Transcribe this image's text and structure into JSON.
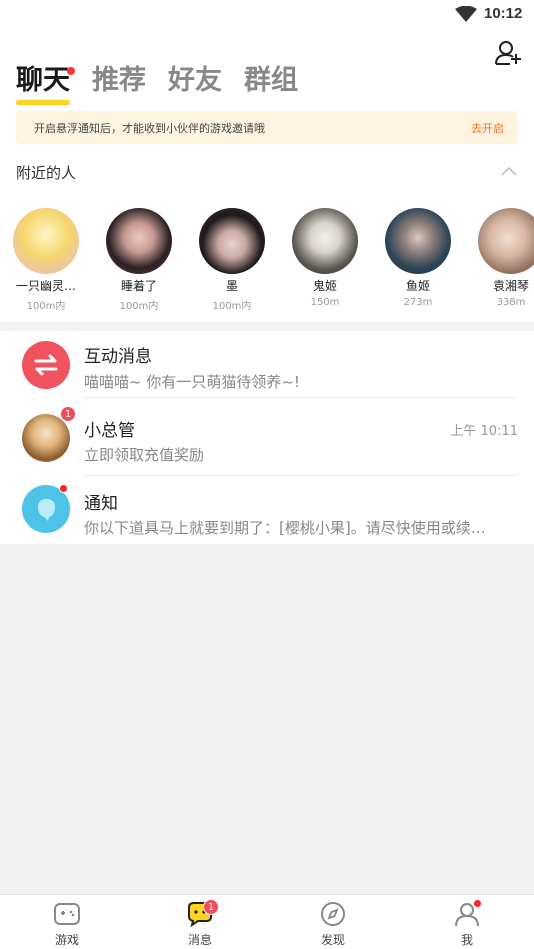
{
  "status_bar": {
    "time": "10:12"
  },
  "tabs": [
    {
      "label": "聊天",
      "active": true,
      "has_dot": true
    },
    {
      "label": "推荐",
      "active": false
    },
    {
      "label": "好友",
      "active": false
    },
    {
      "label": "群组",
      "active": false
    }
  ],
  "notice": {
    "text": "开启悬浮通知后，才能收到小伙伴的游戏邀请哦",
    "action": "去开启"
  },
  "nearby": {
    "title": "附近的人",
    "people": [
      {
        "name": "一只幽灵…",
        "distance": "100m内",
        "color": "#f2c94c"
      },
      {
        "name": "睡着了",
        "distance": "100m内",
        "color": "#3b2f35"
      },
      {
        "name": "墨",
        "distance": "100m内",
        "color": "#2c2629"
      },
      {
        "name": "鬼姬",
        "distance": "150m",
        "color": "#6e6a64"
      },
      {
        "name": "鱼姬",
        "distance": "273m",
        "color": "#3e5566"
      },
      {
        "name": "袁湘琴",
        "distance": "338m",
        "color": "#d9b9a8"
      }
    ]
  },
  "messages": [
    {
      "title": "互动消息",
      "subtitle": "喵喵喵~ 你有一只萌猫待领养~!",
      "time": "",
      "icon": "swap-icon",
      "color": "#f0535e"
    },
    {
      "title": "小总管",
      "subtitle": "立即领取充值奖励",
      "time": "上午 10:11",
      "badge": "1",
      "icon": "avatar",
      "color": "#f5a623"
    },
    {
      "title": "通知",
      "subtitle": "你以下道具马上就要到期了：[樱桃小果]。请尽快使用或续…",
      "time": "",
      "icon": "bubble-icon",
      "color": "#4dc3e8"
    }
  ],
  "bottom_nav": [
    {
      "label": "游戏",
      "active": false
    },
    {
      "label": "消息",
      "active": true,
      "badge": "1"
    },
    {
      "label": "发现",
      "active": false
    },
    {
      "label": "我",
      "active": false,
      "has_dot": true
    }
  ]
}
